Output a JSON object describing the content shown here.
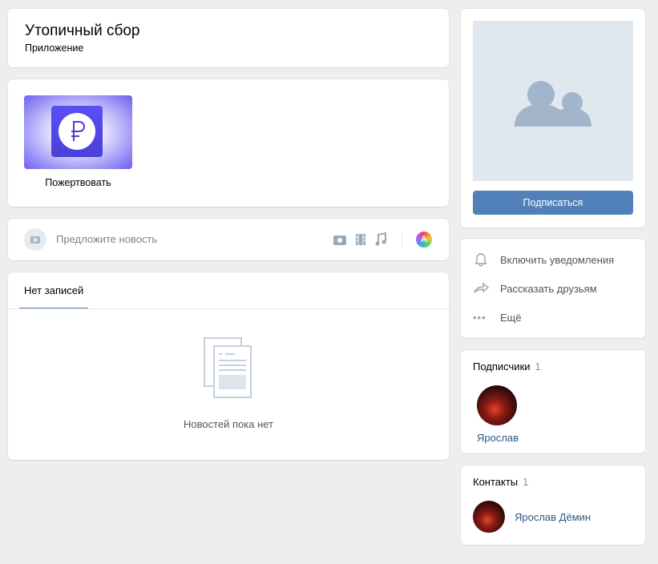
{
  "header": {
    "title": "Утопичный сбор",
    "subtitle": "Приложение"
  },
  "app": {
    "label": "Пожертвовать",
    "icon": "ruble-icon"
  },
  "suggest": {
    "placeholder": "Предложите новость"
  },
  "wall": {
    "tab": "Нет записей",
    "empty": "Новостей пока нет"
  },
  "side": {
    "subscribe": "Подписаться",
    "menu": [
      {
        "label": "Включить уведомления",
        "icon": "bell-icon"
      },
      {
        "label": "Рассказать друзьям",
        "icon": "share-icon"
      },
      {
        "label": "Ещё",
        "icon": "more-icon"
      }
    ],
    "followers": {
      "title": "Подписчики",
      "count": "1",
      "items": [
        {
          "name": "Ярослав"
        }
      ]
    },
    "contacts": {
      "title": "Контакты",
      "count": "1",
      "items": [
        {
          "name": "Ярослав Дёмин"
        }
      ]
    }
  },
  "colors": {
    "accent": "#5181b8",
    "bg": "#edeef0"
  }
}
